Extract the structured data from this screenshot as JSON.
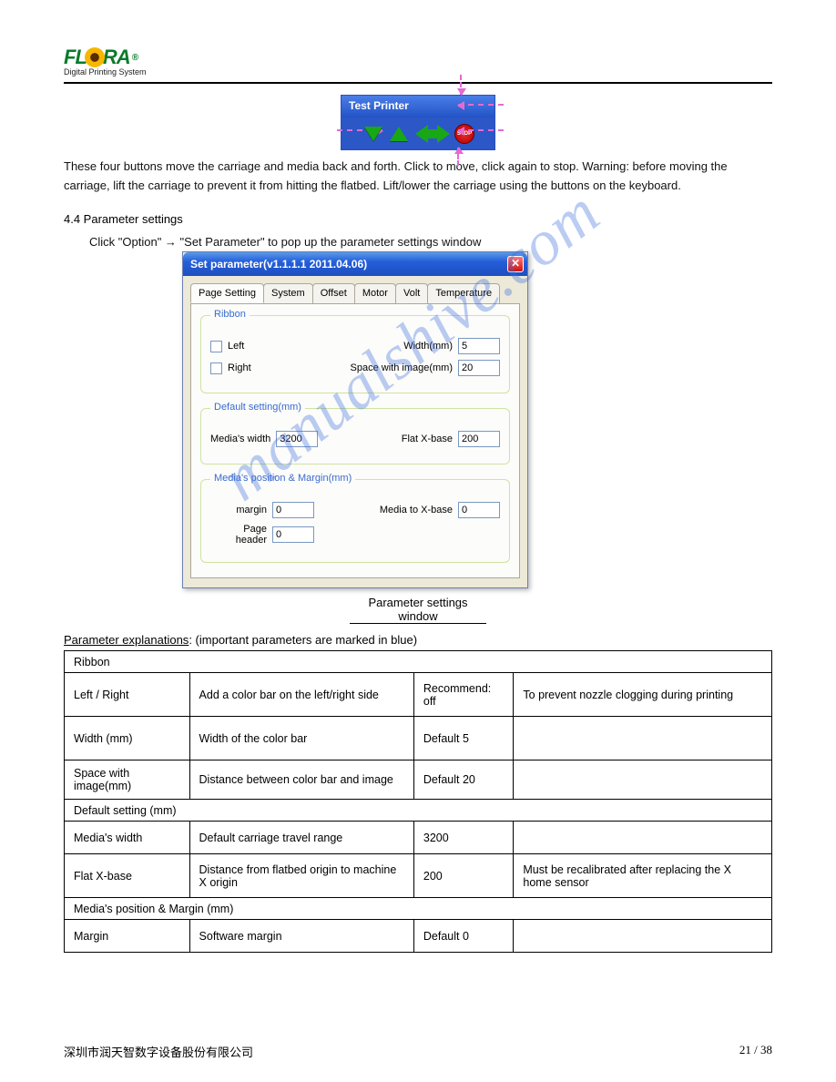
{
  "logo": {
    "text_left": "FL",
    "text_right": "RA",
    "reg": "®",
    "tag": "Digital Printing System"
  },
  "test_printer": {
    "title": "Test Printer",
    "stop": "STOP"
  },
  "para1": "These four buttons move the carriage and media back and forth. Click to move, click again to stop. Warning: before moving the carriage, lift the carriage to prevent it from hitting the flatbed. Lift/lower the carriage using the buttons on the keyboard.",
  "heading_params": "4.4 Parameter settings",
  "para2": "Click \"Option\" → \"Set Parameter\" to pop up the parameter settings window",
  "dialog": {
    "title": "Set parameter(v1.1.1.1 2011.04.06)",
    "tabs": [
      "Page Setting",
      "System",
      "Offset",
      "Motor",
      "Volt",
      "Temperature"
    ],
    "ribbon": {
      "title": "Ribbon",
      "left": "Left",
      "right": "Right",
      "width_label": "Width(mm)",
      "width_value": "5",
      "space_label": "Space with image(mm)",
      "space_value": "20"
    },
    "default": {
      "title": "Default setting(mm)",
      "media_width_label": "Media's width",
      "media_width_value": "3200",
      "flat_label": "Flat X-base",
      "flat_value": "200"
    },
    "margin_grp": {
      "title": "Media's position & Margin(mm)",
      "margin_label": "margin",
      "margin_value": "0",
      "media_to_label": "Media to X-base",
      "media_to_value": "0",
      "header_label": "Page header",
      "header_value": "0"
    }
  },
  "caption_under": "Parameter settings window",
  "explain_lead": "Parameter explanations",
  "explain_tail": ": (important parameters are marked in blue)",
  "table": {
    "group_ribbon": "Ribbon",
    "rows_ribbon": [
      {
        "c1": "Left / Right",
        "c2": "Add a color bar on the left/right side",
        "c3": "Recommend: off",
        "c4": "To prevent nozzle clogging during printing"
      },
      {
        "c1": "Width (mm)",
        "c2": "Width of the color bar",
        "c3": "Default 5",
        "c4": ""
      },
      {
        "c1": "Space with image(mm)",
        "c2": "Distance between color bar and image",
        "c3": "Default 20",
        "c4": ""
      }
    ],
    "group_default": "Default setting (mm)",
    "rows_default": [
      {
        "c1": "Media's width",
        "c2": "Default carriage travel range",
        "c3": "3200",
        "c4": ""
      },
      {
        "c1": "Flat X-base",
        "c2": "Distance from flatbed origin to machine X origin",
        "c3": "200",
        "c4": "Must be recalibrated after replacing the X home sensor"
      }
    ],
    "group_margin": "Media's position & Margin (mm)",
    "rows_margin": [
      {
        "c1": "Margin",
        "c2": "Software margin",
        "c3": "Default 0",
        "c4": ""
      }
    ]
  },
  "footer": {
    "left": "深圳市润天智数字设备股份有限公司",
    "right": "21 / 38"
  }
}
